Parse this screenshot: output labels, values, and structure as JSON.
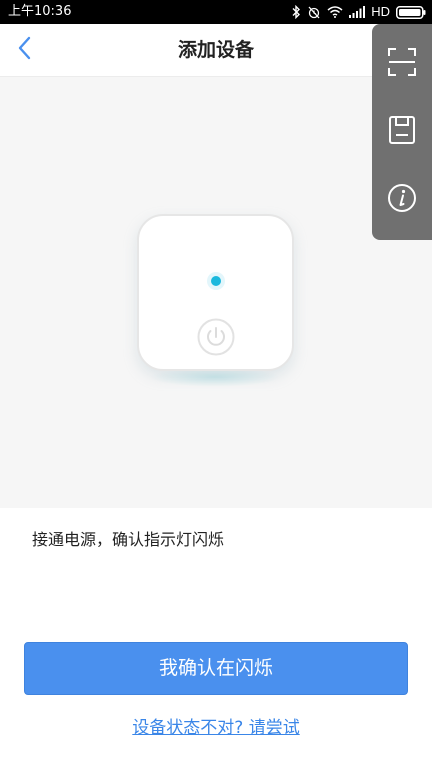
{
  "status_bar": {
    "time": "上午10:36",
    "network_label": "HD",
    "icons": [
      "bluetooth-icon",
      "alarm-off-icon",
      "wifi-icon",
      "signal-icon",
      "battery-icon"
    ]
  },
  "header": {
    "title": "添加设备",
    "back_icon": "chevron-left-icon",
    "accent_color": "#4a90ee"
  },
  "toolbar": {
    "icons": [
      "scan-icon",
      "save-icon",
      "info-icon"
    ],
    "background_color": "#707070"
  },
  "device": {
    "indicator_color": "#1ab8dd",
    "icons": [
      "indicator-light-icon",
      "power-icon"
    ]
  },
  "instruction": {
    "text": "接通电源，确认指示灯闪烁"
  },
  "actions": {
    "confirm_label": "我确认在闪烁",
    "help_label": "设备状态不对? 请尝试",
    "primary_color": "#4a90ee",
    "link_color": "#3a86e8"
  }
}
